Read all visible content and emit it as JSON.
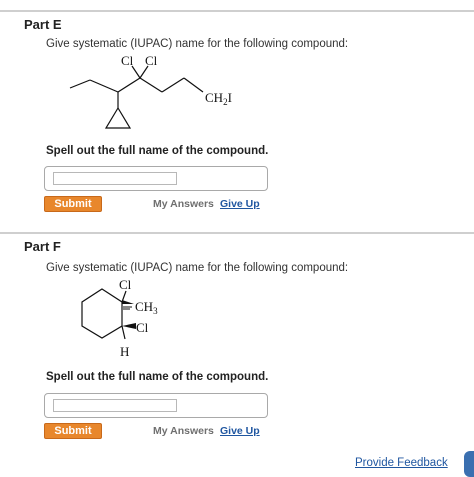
{
  "part_e": {
    "title": "Part E",
    "question": "Give systematic (IUPAC) name for the following compound:",
    "structure_labels": {
      "cl_1": "Cl",
      "cl_2": "Cl",
      "ch2i": "CH",
      "ch2i_sub": "2",
      "ch2i_tail": "I"
    },
    "instruction": "Spell out the full name of the compound.",
    "answer_value": "",
    "submit_label": "Submit",
    "my_answers_label": "My Answers",
    "give_up_label": "Give Up"
  },
  "part_f": {
    "title": "Part F",
    "question": "Give systematic (IUPAC) name for the following compound:",
    "structure_labels": {
      "cl_top": "Cl",
      "ch3": "CH",
      "ch3_sub": "3",
      "cl_mid": "Cl",
      "h": "H"
    },
    "instruction": "Spell out the full name of the compound.",
    "answer_value": "",
    "submit_label": "Submit",
    "my_answers_label": "My Answers",
    "give_up_label": "Give Up"
  },
  "footer": {
    "feedback_label": "Provide Feedback"
  },
  "colors": {
    "submit": "#e8872c",
    "link": "#1f56a0",
    "side_tab": "#3a6fb0"
  }
}
